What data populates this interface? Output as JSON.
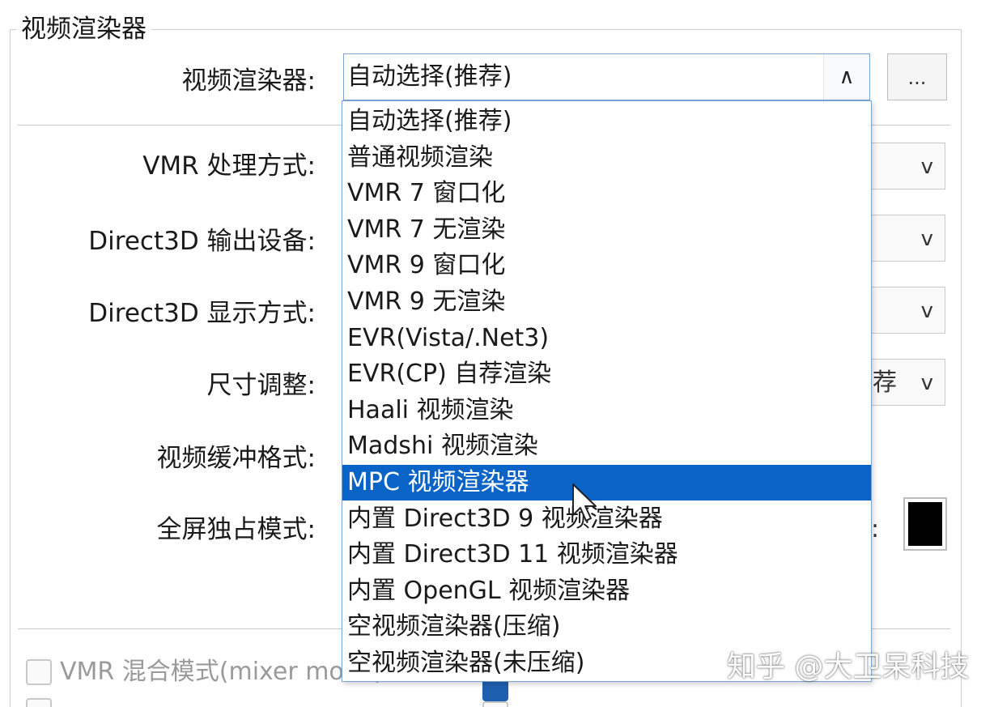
{
  "group": {
    "title": "视频渲染器"
  },
  "fields": {
    "renderer_label": "视频渲染器:",
    "vmr_label": "VMR 处理方式:",
    "d3d_device_label": "Direct3D 输出设备:",
    "d3d_display_label": "Direct3D 显示方式:",
    "resize_label": "尺寸调整:",
    "buffer_label": "视频缓冲格式:",
    "fullscreen_label": "全屏独占模式:"
  },
  "renderer_combo": {
    "value": "自动选择(推荐)",
    "arrow": "∧",
    "more_label": "..."
  },
  "right_stubs": {
    "arrow": "v",
    "resize_partial_text": "荐",
    "colon": ":"
  },
  "colors": {
    "accent": "#0a64c8",
    "swatch": "#000000"
  },
  "dropdown": {
    "options": [
      "自动选择(推荐)",
      "普通视频渲染",
      "VMR 7 窗口化",
      "VMR 7 无渲染",
      "VMR 9 窗口化",
      "VMR 9 无渲染",
      "EVR(Vista/.Net3)",
      "EVR(CP) 自荐渲染",
      "Haali 视频渲染",
      "Madshi 视频渲染",
      "MPC 视频渲染器",
      "内置 Direct3D 9 视频渲染器",
      "内置 Direct3D 11 视频渲染器",
      "内置 OpenGL 视频渲染器",
      "空视频渲染器(压缩)",
      "空视频渲染器(未压缩)"
    ],
    "selected_index": 10
  },
  "bottom": {
    "vmr_mix_label": "VMR 混合模式(mixer mode)"
  },
  "watermark": "知乎 @大卫呆科技"
}
